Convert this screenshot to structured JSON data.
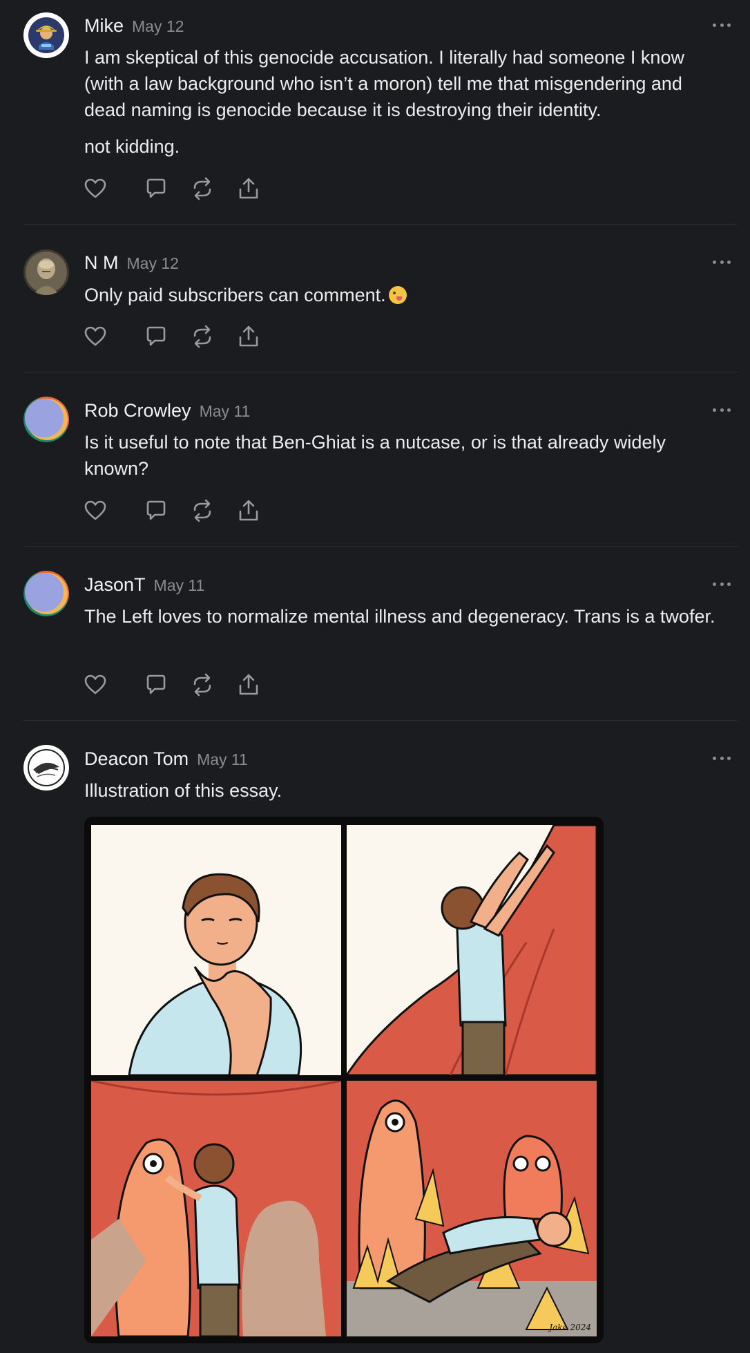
{
  "comments": [
    {
      "author": "Mike",
      "date": "May 12",
      "paragraphs": [
        "I am skeptical of this genocide accusation. I literally had someone I know (with a law background who isn’t a moron) tell me that misgendering and dead naming is genocide because it is destroying their identity.",
        "not kidding."
      ]
    },
    {
      "author": "N M",
      "date": "May 12",
      "text": "Only paid subscribers can comment."
    },
    {
      "author": "Rob Crowley",
      "date": "May 11",
      "text": "Is it useful to note that Ben-Ghiat is a nutcase, or is that already widely known?"
    },
    {
      "author": "JasonT",
      "date": "May 11",
      "text": "The Left loves to normalize mental illness and degeneracy. Trans is a twofer."
    },
    {
      "author": "Deacon Tom",
      "date": "May 11",
      "text": "Illustration of this essay.",
      "image_signature": "Jake 2024"
    }
  ],
  "icons": {
    "like": "heart-icon",
    "reply": "comment-bubble-icon",
    "restack": "restack-arrows-icon",
    "share": "share-upload-icon",
    "more": "more-horizontal-icon"
  },
  "colors": {
    "background": "#1b1c1f",
    "text": "#ececec",
    "muted": "#8b8c90",
    "divider": "#2d2e32"
  }
}
